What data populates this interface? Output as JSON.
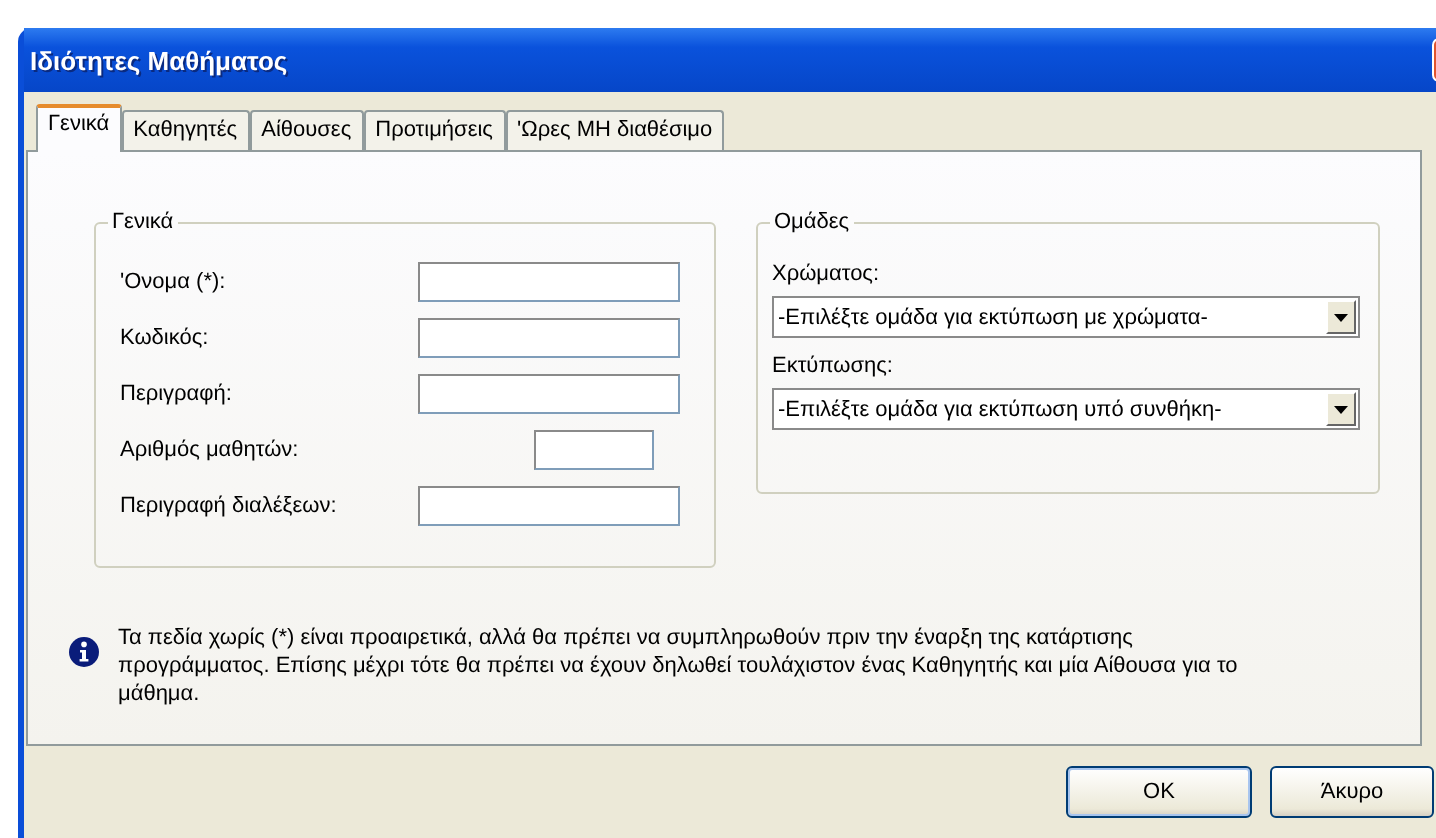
{
  "window": {
    "title": "Ιδιότητες Μαθήματος"
  },
  "tabs": [
    {
      "label": "Γενικά",
      "selected": true
    },
    {
      "label": "Καθηγητές",
      "selected": false
    },
    {
      "label": "Αίθουσες",
      "selected": false
    },
    {
      "label": "Προτιμήσεις",
      "selected": false
    },
    {
      "label": "'Ωρες ΜΗ διαθέσιμο",
      "selected": false
    }
  ],
  "general_group": {
    "title": "Γενικά",
    "fields": [
      {
        "label": "'Ονομα (*):",
        "kind": "wide"
      },
      {
        "label": "Κωδικός:",
        "kind": "wide"
      },
      {
        "label": "Περιγραφή:",
        "kind": "wide"
      },
      {
        "label": "Αριθμός μαθητών:",
        "kind": "short"
      },
      {
        "label": "Περιγραφή διαλέξεων:",
        "kind": "wide"
      }
    ]
  },
  "groups_group": {
    "title": "Ομάδες",
    "dropdowns": [
      {
        "label": "Χρώματος:",
        "value": "-Επιλέξτε ομάδα για εκτύπωση με χρώματα-"
      },
      {
        "label": "Εκτύπωσης:",
        "value": "-Επιλέξτε ομάδα για εκτύπωση υπό συνθήκη-"
      }
    ]
  },
  "info_note": "Τα πεδία χωρίς (*) είναι προαιρετικά, αλλά θα πρέπει να συμπληρωθούν πριν την έναρξη της κατάρτισης προγράμματος.  Επίσης μέχρι τότε θα πρέπει να έχουν δηλωθεί τουλάχιστον ένας Καθηγητής και μία Αίθουσα για το μάθημα.",
  "buttons": [
    "OK",
    "Άκυρο"
  ]
}
